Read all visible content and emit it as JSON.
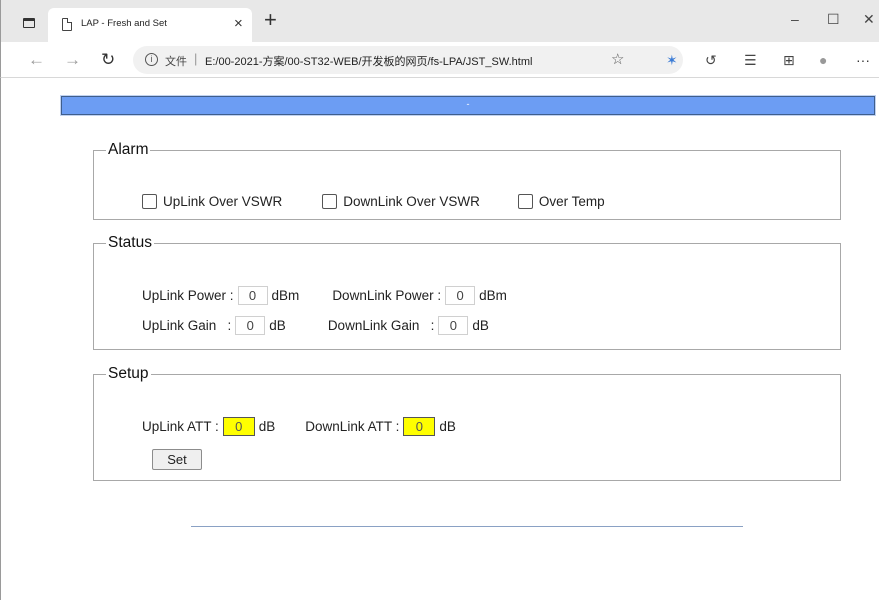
{
  "browser": {
    "tab_title": "LAP - Fresh and Set",
    "tab_close": "×",
    "new_tab": "+",
    "window": {
      "minimize": "–",
      "maximize": "☐",
      "close": "✕"
    },
    "address_label": "文件",
    "address_separator": "|",
    "url": "E:/00-2021-方案/00-ST32-WEB/开发板的网页/fs-LPA/JST_SW.html",
    "icons": [
      "back-icon",
      "forward-icon",
      "refresh-icon",
      "info-icon",
      "favorite-add-icon",
      "extension-icon",
      "sync-icon",
      "favorites-icon",
      "collections-icon",
      "profile-icon",
      "more-icon"
    ],
    "more": "···"
  },
  "page": {
    "header_text": "-",
    "alarm": {
      "legend": "Alarm",
      "items": [
        "UpLink Over VSWR",
        "DownLink Over VSWR",
        "Over Temp"
      ]
    },
    "status": {
      "legend": "Status",
      "uplink_power_label": "UpLink Power :",
      "uplink_power_value": "0",
      "uplink_power_unit": "dBm",
      "downlink_power_label": "DownLink Power :",
      "downlink_power_value": "0",
      "downlink_power_unit": "dBm",
      "uplink_gain_label": "UpLink Gain   :",
      "uplink_gain_value": "0",
      "uplink_gain_unit": "dB",
      "downlink_gain_label": "DownLink Gain   :",
      "downlink_gain_value": "0",
      "downlink_gain_unit": "dB"
    },
    "setup": {
      "legend": "Setup",
      "uplink_att_label": "UpLink ATT :",
      "uplink_att_value": "0",
      "uplink_att_unit": "dB",
      "downlink_att_label": "DownLink ATT :",
      "downlink_att_value": "0",
      "downlink_att_unit": "dB",
      "set_button": "Set",
      "att_color": "#ffff00"
    },
    "header_color": "#6c9df3"
  }
}
